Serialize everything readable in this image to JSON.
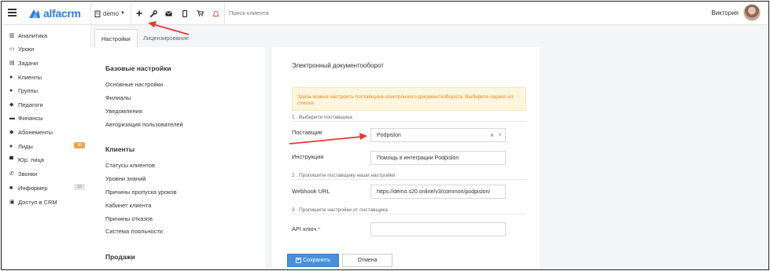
{
  "topbar": {
    "logo_text": "alfacrm",
    "branch_label": "demo",
    "search_placeholder": "Поиск клиента",
    "user_name": "Виктория",
    "icons": [
      "plus-icon",
      "wrench-icon",
      "envelope-icon",
      "mobile-icon",
      "cart-icon",
      "bell-icon"
    ]
  },
  "sidebar": {
    "items": [
      {
        "label": "Аналитика",
        "icon": "analytics-icon"
      },
      {
        "label": "Уроки",
        "icon": "calendar-icon"
      },
      {
        "label": "Задачи",
        "icon": "tasks-icon"
      },
      {
        "label": "Клиенты",
        "icon": "user-icon"
      },
      {
        "label": "Группы",
        "icon": "users-icon"
      },
      {
        "label": "Педагоги",
        "icon": "graduation-cap-icon"
      },
      {
        "label": "Финансы",
        "icon": "money-icon"
      },
      {
        "label": "Абонементы",
        "icon": "tag-icon"
      },
      {
        "label": "Лиды",
        "icon": "user-plus-icon",
        "badge": "30"
      },
      {
        "label": "Юр. лица",
        "icon": "briefcase-icon"
      },
      {
        "label": "Звонки",
        "icon": "phone-icon"
      },
      {
        "label": "Информер",
        "icon": "informer-icon",
        "badge": "10"
      },
      {
        "label": "Доступ в CRM",
        "icon": "lock-icon"
      }
    ]
  },
  "tabs": [
    {
      "label": "Настройки",
      "active": true
    },
    {
      "label": "Лицензирование",
      "active": false
    }
  ],
  "settings_menu": {
    "base_title": "Базовые настройки",
    "base_items": [
      "Основные настройки",
      "Филиалы",
      "Уведомления",
      "Авторизация пользователей"
    ],
    "clients_title": "Клиенты",
    "clients_items": [
      "Статусы клиентов",
      "Уровни знаний",
      "Причины пропуска уроков",
      "Кабинет клиента",
      "Причины отказов",
      "Система лояльности"
    ],
    "sales_title": "Продажи"
  },
  "main": {
    "title": "Электронный документооборот",
    "alert": "Здесь можно настроить поставщика электронного документооборота. Выберите сервис из списка.",
    "step1": "1 . Выберите поставщика",
    "provider_label": "Поставщик",
    "provider_value": "Podpislon",
    "instruction_label": "Инструкция",
    "instruction_value": "Помощь в интеграции Podpislon",
    "step2": "2 . Пропишите поставщику наши настройки",
    "webhook_label": "Webhook URL",
    "webhook_value": "https://demo.s20.online/v3/common/podpislon/",
    "step3": "3 . Пропишите настройки от поставщика",
    "api_label": "API ключ",
    "api_required": "*",
    "api_value": ""
  },
  "buttons": {
    "save": "Сохранить",
    "cancel": "Отмена"
  },
  "colors": {
    "accent": "#4a8fd9",
    "brand": "#2f7be5",
    "alert_bg": "#fdf5dc",
    "alert_text": "#e08a2b",
    "arrow": "#e53935",
    "badge_orange": "#f0a34a"
  }
}
